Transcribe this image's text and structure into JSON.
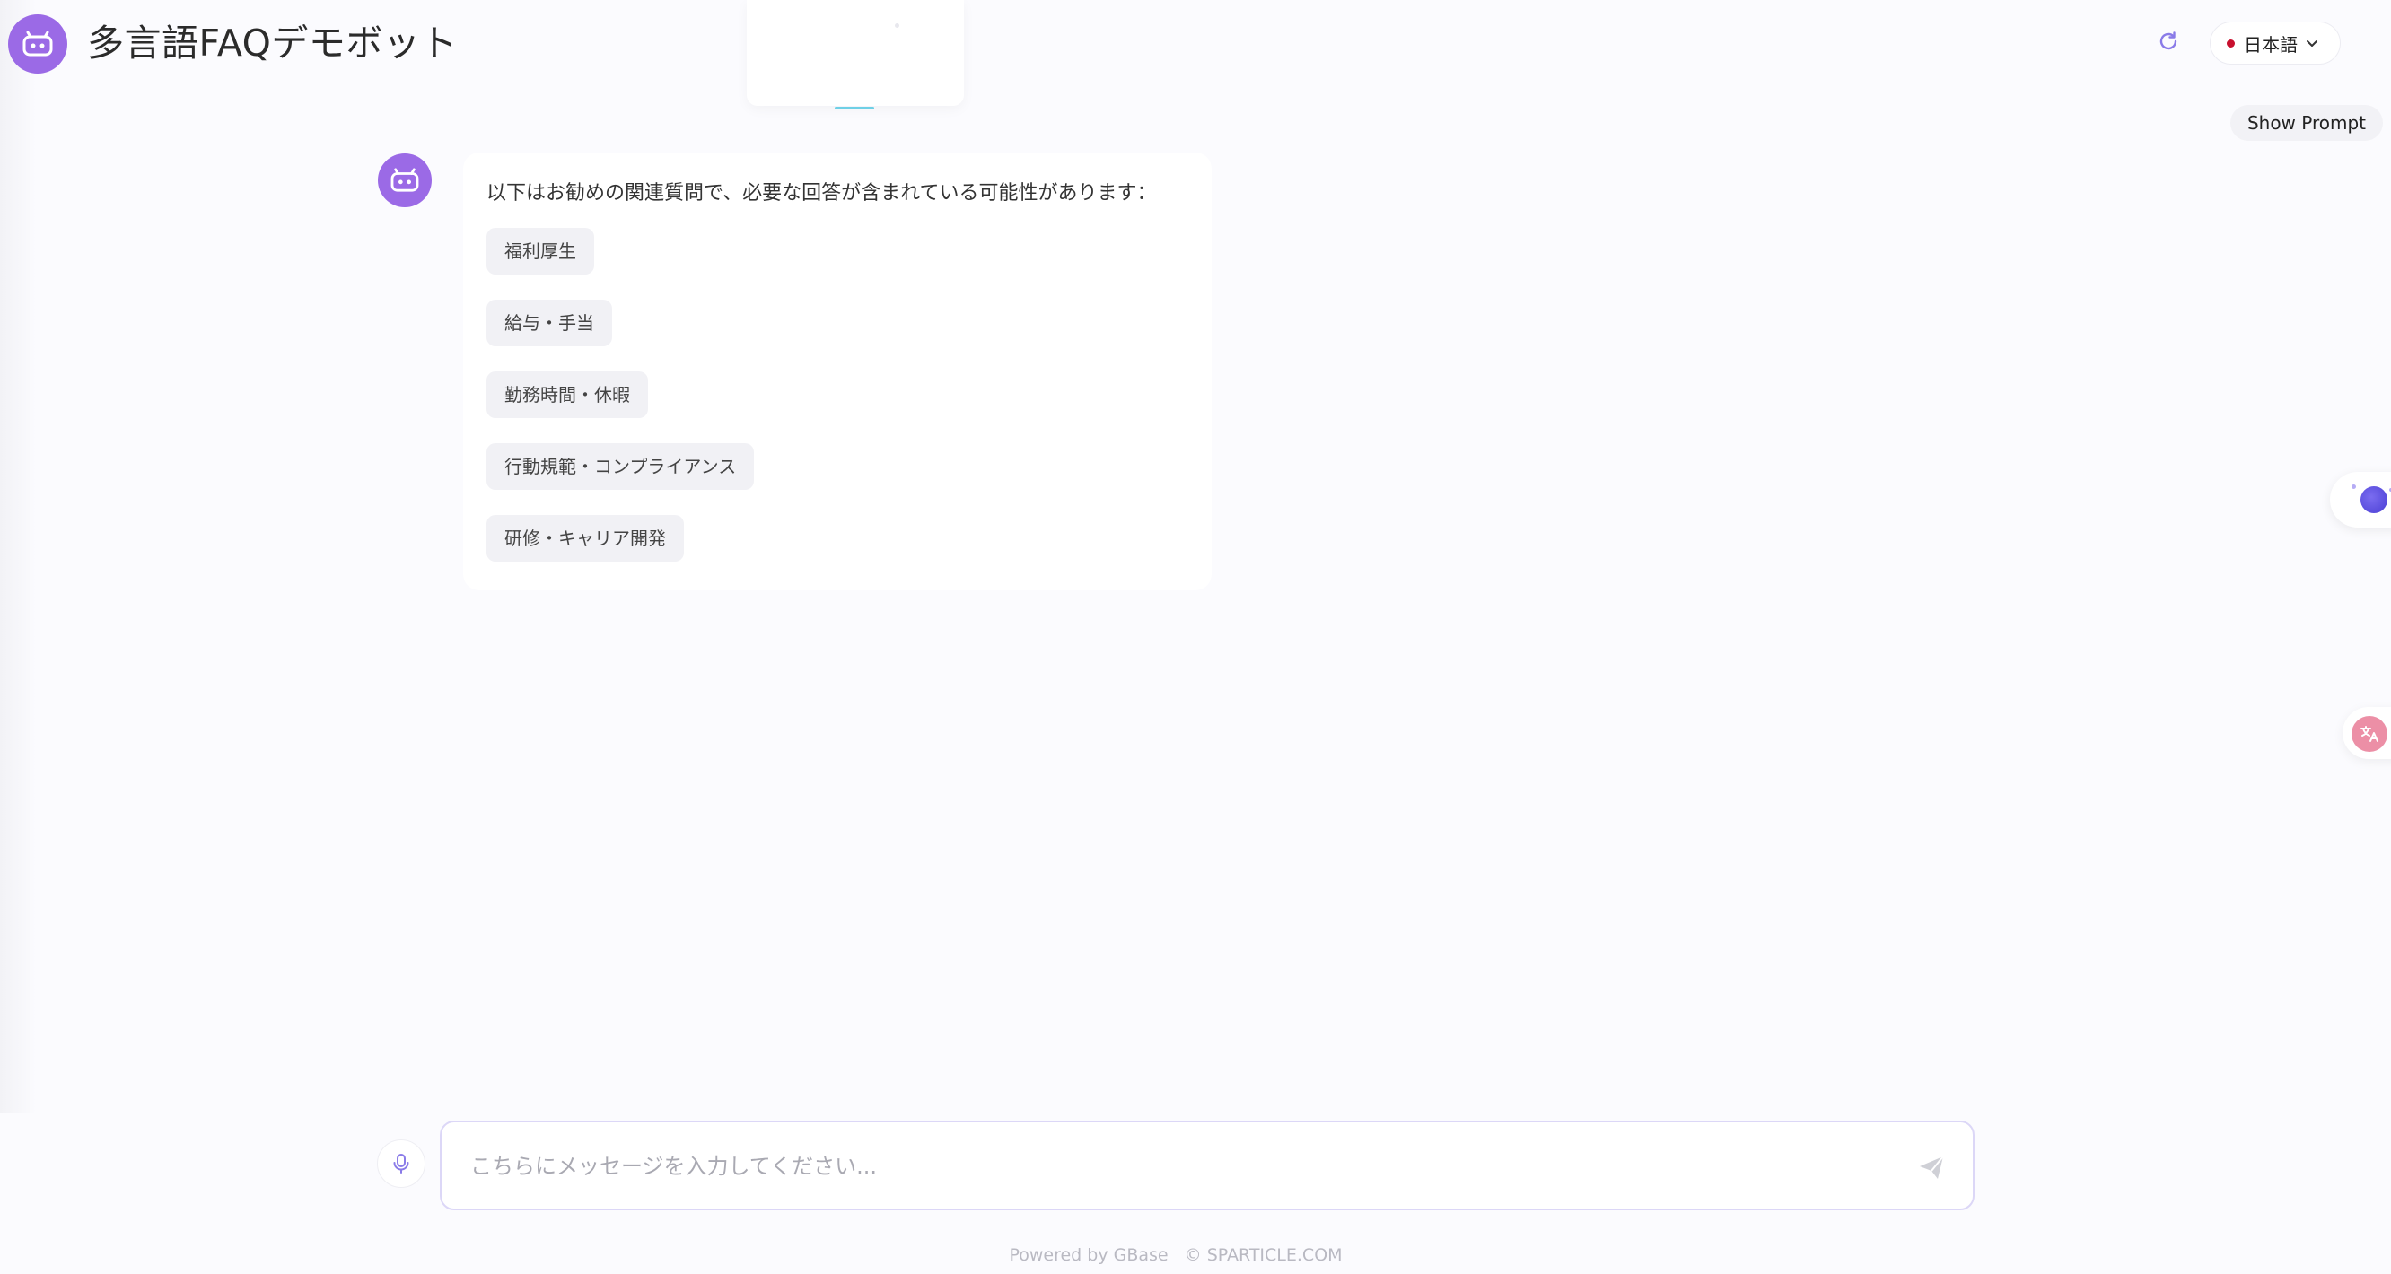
{
  "header": {
    "title": "多言語FAQデモボット",
    "language": "日本語",
    "show_prompt_label": "Show Prompt"
  },
  "icons": {
    "brand_avatar": "robot-icon",
    "refresh": "refresh-icon",
    "language_flag": "japan-flag-icon",
    "dropdown": "chevron-down-icon",
    "voice": "microphone-icon",
    "send": "send-icon",
    "float_mic": "voice-assistant-icon",
    "float_translate": "translate-icon"
  },
  "colors": {
    "brand": "#9b6ae6",
    "background": "#fbfbfe",
    "chip_background": "#f1f1f5",
    "input_border": "#dcd7f7"
  },
  "chat": {
    "message": {
      "intro": "以下はお勧めの関連質問で、必要な回答が含まれている可能性があります：",
      "suggestions": [
        {
          "label": "福利厚生"
        },
        {
          "label": "給与・手当"
        },
        {
          "label": "勤務時間・休暇"
        },
        {
          "label": "行動規範・コンプライアンス"
        },
        {
          "label": "研修・キャリア開発"
        }
      ]
    }
  },
  "input": {
    "placeholder": "こちらにメッセージを入力してください...",
    "value": ""
  },
  "footer": {
    "powered_by": "Powered by GBase",
    "copyright": "© SPARTICLE.COM"
  }
}
